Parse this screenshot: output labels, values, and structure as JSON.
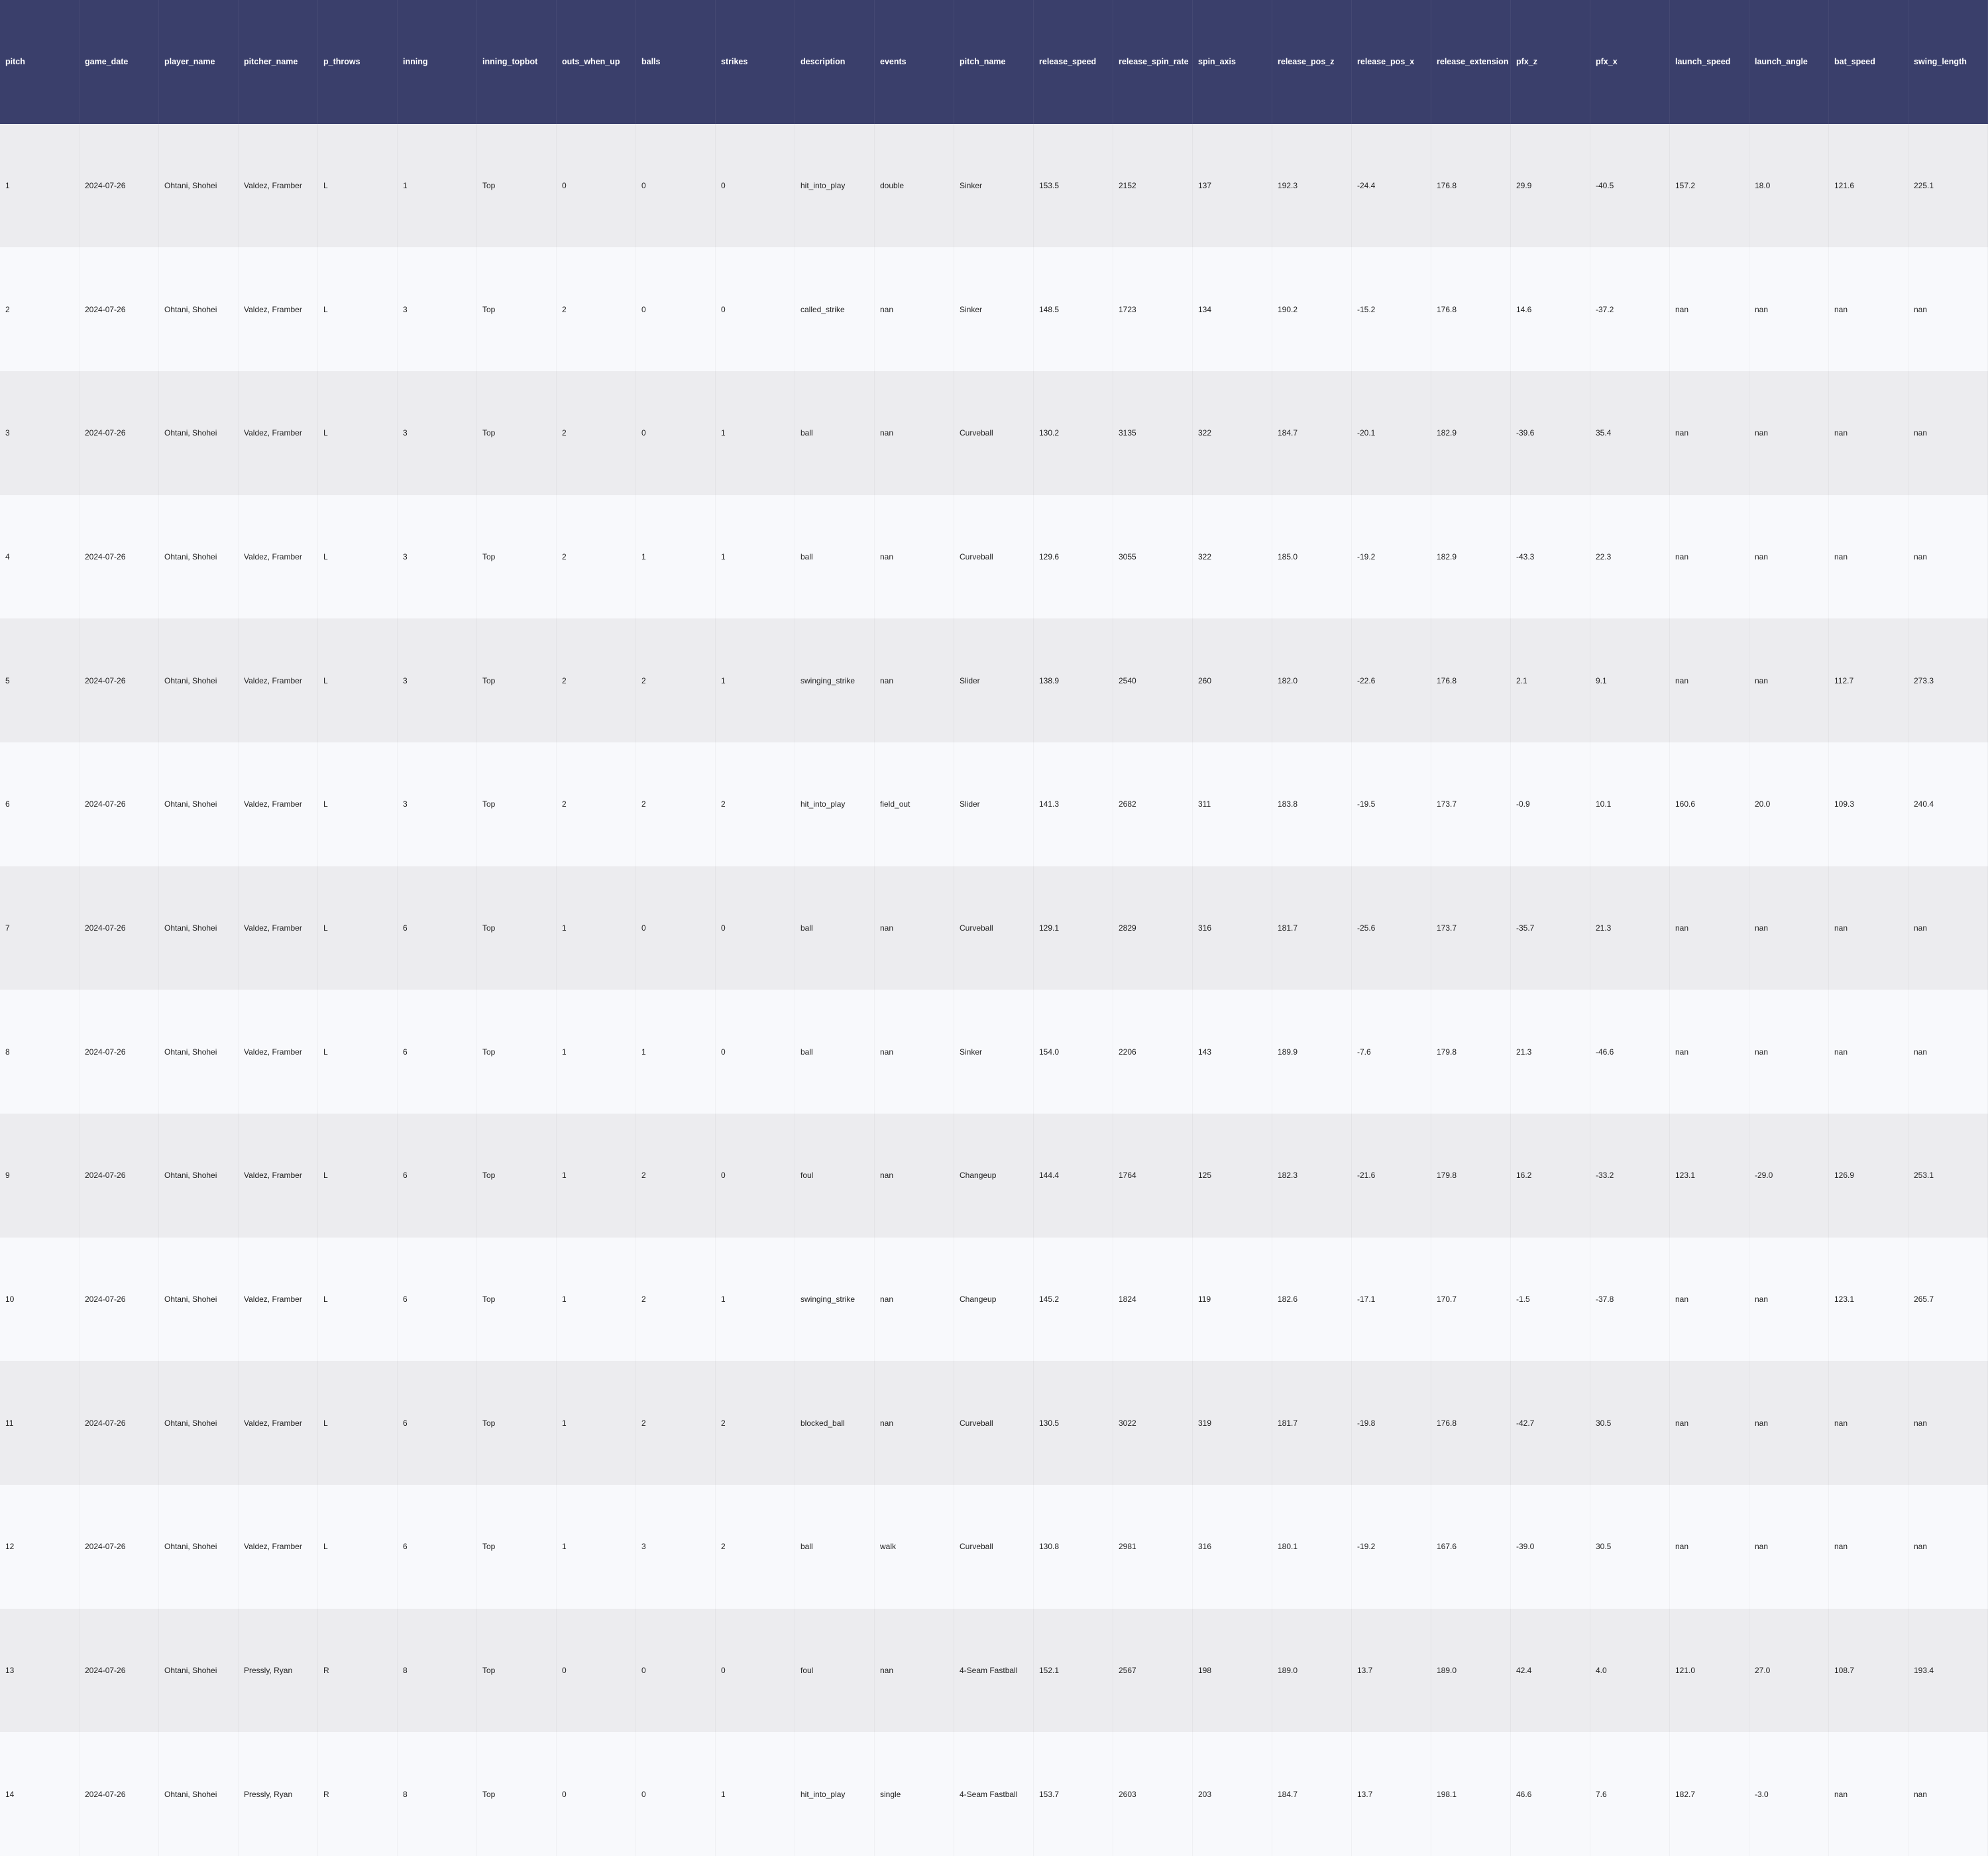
{
  "colors": {
    "header_bg": "#3a3f6b",
    "header_text": "#ffffff",
    "row_odd_bg": "#ececef",
    "row_even_bg": "#f8f9fc",
    "cell_text": "#222222"
  },
  "chart_data": {
    "type": "table",
    "columns": [
      "pitch",
      "game_date",
      "player_name",
      "pitcher_name",
      "p_throws",
      "inning",
      "inning_topbot",
      "outs_when_up",
      "balls",
      "strikes",
      "description",
      "events",
      "pitch_name",
      "release_speed",
      "release_spin_rate",
      "spin_axis",
      "release_pos_z",
      "release_pos_x",
      "release_extension",
      "pfx_z",
      "pfx_x",
      "launch_speed",
      "launch_angle",
      "bat_speed",
      "swing_length"
    ],
    "rows": [
      [
        "1",
        "2024-07-26",
        "Ohtani, Shohei",
        "Valdez, Framber",
        "L",
        "1",
        "Top",
        "0",
        "0",
        "0",
        "hit_into_play",
        "double",
        "Sinker",
        "153.5",
        "2152",
        "137",
        "192.3",
        "-24.4",
        "176.8",
        "29.9",
        "-40.5",
        "157.2",
        "18.0",
        "121.6",
        "225.1"
      ],
      [
        "2",
        "2024-07-26",
        "Ohtani, Shohei",
        "Valdez, Framber",
        "L",
        "3",
        "Top",
        "2",
        "0",
        "0",
        "called_strike",
        "nan",
        "Sinker",
        "148.5",
        "1723",
        "134",
        "190.2",
        "-15.2",
        "176.8",
        "14.6",
        "-37.2",
        "nan",
        "nan",
        "nan",
        "nan"
      ],
      [
        "3",
        "2024-07-26",
        "Ohtani, Shohei",
        "Valdez, Framber",
        "L",
        "3",
        "Top",
        "2",
        "0",
        "1",
        "ball",
        "nan",
        "Curveball",
        "130.2",
        "3135",
        "322",
        "184.7",
        "-20.1",
        "182.9",
        "-39.6",
        "35.4",
        "nan",
        "nan",
        "nan",
        "nan"
      ],
      [
        "4",
        "2024-07-26",
        "Ohtani, Shohei",
        "Valdez, Framber",
        "L",
        "3",
        "Top",
        "2",
        "1",
        "1",
        "ball",
        "nan",
        "Curveball",
        "129.6",
        "3055",
        "322",
        "185.0",
        "-19.2",
        "182.9",
        "-43.3",
        "22.3",
        "nan",
        "nan",
        "nan",
        "nan"
      ],
      [
        "5",
        "2024-07-26",
        "Ohtani, Shohei",
        "Valdez, Framber",
        "L",
        "3",
        "Top",
        "2",
        "2",
        "1",
        "swinging_strike",
        "nan",
        "Slider",
        "138.9",
        "2540",
        "260",
        "182.0",
        "-22.6",
        "176.8",
        "2.1",
        "9.1",
        "nan",
        "nan",
        "112.7",
        "273.3"
      ],
      [
        "6",
        "2024-07-26",
        "Ohtani, Shohei",
        "Valdez, Framber",
        "L",
        "3",
        "Top",
        "2",
        "2",
        "2",
        "hit_into_play",
        "field_out",
        "Slider",
        "141.3",
        "2682",
        "311",
        "183.8",
        "-19.5",
        "173.7",
        "-0.9",
        "10.1",
        "160.6",
        "20.0",
        "109.3",
        "240.4"
      ],
      [
        "7",
        "2024-07-26",
        "Ohtani, Shohei",
        "Valdez, Framber",
        "L",
        "6",
        "Top",
        "1",
        "0",
        "0",
        "ball",
        "nan",
        "Curveball",
        "129.1",
        "2829",
        "316",
        "181.7",
        "-25.6",
        "173.7",
        "-35.7",
        "21.3",
        "nan",
        "nan",
        "nan",
        "nan"
      ],
      [
        "8",
        "2024-07-26",
        "Ohtani, Shohei",
        "Valdez, Framber",
        "L",
        "6",
        "Top",
        "1",
        "1",
        "0",
        "ball",
        "nan",
        "Sinker",
        "154.0",
        "2206",
        "143",
        "189.9",
        "-7.6",
        "179.8",
        "21.3",
        "-46.6",
        "nan",
        "nan",
        "nan",
        "nan"
      ],
      [
        "9",
        "2024-07-26",
        "Ohtani, Shohei",
        "Valdez, Framber",
        "L",
        "6",
        "Top",
        "1",
        "2",
        "0",
        "foul",
        "nan",
        "Changeup",
        "144.4",
        "1764",
        "125",
        "182.3",
        "-21.6",
        "179.8",
        "16.2",
        "-33.2",
        "123.1",
        "-29.0",
        "126.9",
        "253.1"
      ],
      [
        "10",
        "2024-07-26",
        "Ohtani, Shohei",
        "Valdez, Framber",
        "L",
        "6",
        "Top",
        "1",
        "2",
        "1",
        "swinging_strike",
        "nan",
        "Changeup",
        "145.2",
        "1824",
        "119",
        "182.6",
        "-17.1",
        "170.7",
        "-1.5",
        "-37.8",
        "nan",
        "nan",
        "123.1",
        "265.7"
      ],
      [
        "11",
        "2024-07-26",
        "Ohtani, Shohei",
        "Valdez, Framber",
        "L",
        "6",
        "Top",
        "1",
        "2",
        "2",
        "blocked_ball",
        "nan",
        "Curveball",
        "130.5",
        "3022",
        "319",
        "181.7",
        "-19.8",
        "176.8",
        "-42.7",
        "30.5",
        "nan",
        "nan",
        "nan",
        "nan"
      ],
      [
        "12",
        "2024-07-26",
        "Ohtani, Shohei",
        "Valdez, Framber",
        "L",
        "6",
        "Top",
        "1",
        "3",
        "2",
        "ball",
        "walk",
        "Curveball",
        "130.8",
        "2981",
        "316",
        "180.1",
        "-19.2",
        "167.6",
        "-39.0",
        "30.5",
        "nan",
        "nan",
        "nan",
        "nan"
      ],
      [
        "13",
        "2024-07-26",
        "Ohtani, Shohei",
        "Pressly, Ryan",
        "R",
        "8",
        "Top",
        "0",
        "0",
        "0",
        "foul",
        "nan",
        "4-Seam Fastball",
        "152.1",
        "2567",
        "198",
        "189.0",
        "13.7",
        "189.0",
        "42.4",
        "4.0",
        "121.0",
        "27.0",
        "108.7",
        "193.4"
      ],
      [
        "14",
        "2024-07-26",
        "Ohtani, Shohei",
        "Pressly, Ryan",
        "R",
        "8",
        "Top",
        "0",
        "0",
        "1",
        "hit_into_play",
        "single",
        "4-Seam Fastball",
        "153.7",
        "2603",
        "203",
        "184.7",
        "13.7",
        "198.1",
        "46.6",
        "7.6",
        "182.7",
        "-3.0",
        "nan",
        "nan"
      ]
    ]
  }
}
